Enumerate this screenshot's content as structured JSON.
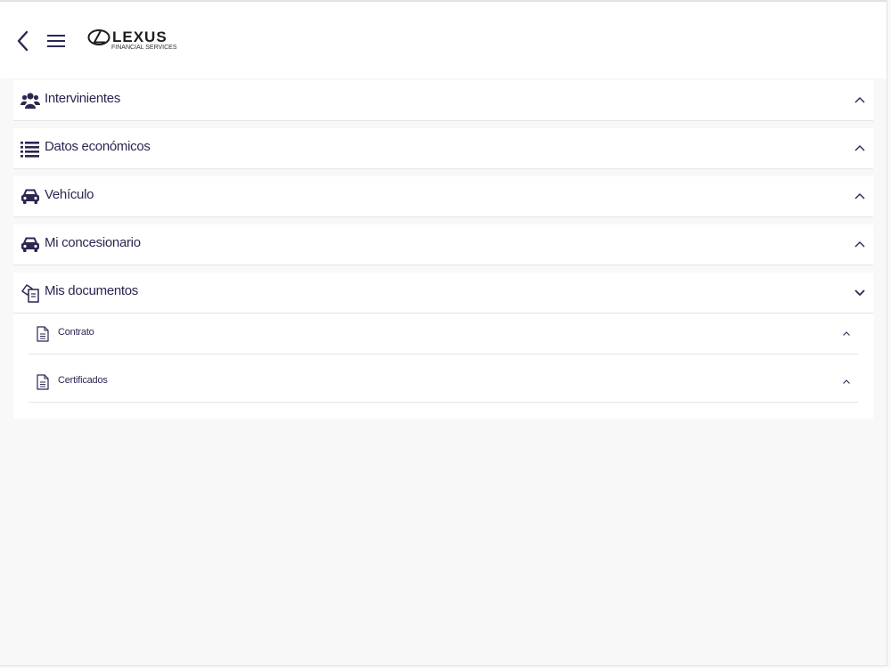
{
  "header": {
    "brand_word": "LEXUS",
    "brand_sub": "FINANCIAL SERVICES",
    "back_icon": "chevron-left-icon",
    "menu_icon": "hamburger-menu-icon"
  },
  "colors": {
    "accent": "#2b2750",
    "panel_bg": "#ffffff",
    "page_bg": "#f8f8f8",
    "divider": "#e4e4e4"
  },
  "sections": [
    {
      "label": "Intervinientes",
      "icon": "users-icon",
      "state": "collapsed"
    },
    {
      "label": "Datos económicos",
      "icon": "list-icon",
      "state": "collapsed"
    },
    {
      "label": "Vehículo",
      "icon": "car-icon",
      "state": "collapsed"
    },
    {
      "label": "Mi concesionario",
      "icon": "car-icon",
      "state": "collapsed"
    },
    {
      "label": "Mis documentos",
      "icon": "documents-icon",
      "state": "expanded"
    }
  ],
  "documents": [
    {
      "label": "Contrato",
      "icon": "file-icon"
    },
    {
      "label": "Certificados",
      "icon": "file-icon"
    }
  ]
}
